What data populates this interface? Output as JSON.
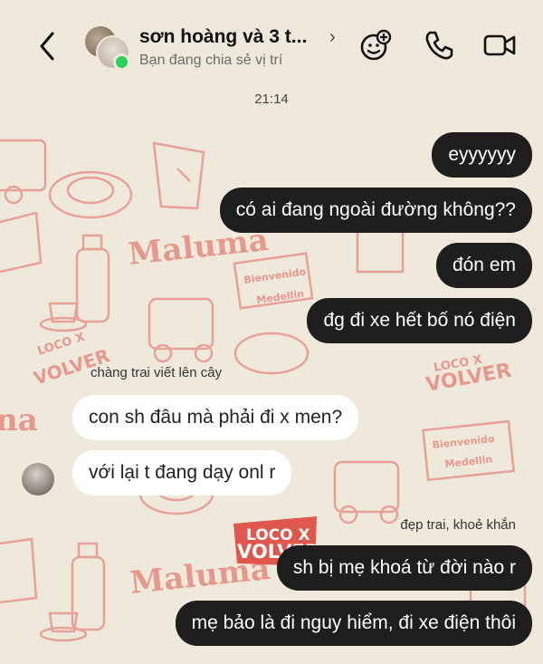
{
  "header": {
    "title": "sơn hoàng và 3 t...",
    "subtitle": "Bạn đang chia sẻ vị trí",
    "icons": [
      "back-arrow-icon",
      "chevron-right-icon",
      "add-effects-icon",
      "phone-icon",
      "video-camera-icon"
    ]
  },
  "timestamp": "21:14",
  "wallpaper_text": {
    "maluma_1": "Maluma",
    "maluma_2": "Maluma",
    "volver_1": "VOLVER",
    "volver_2": "VOLVER",
    "volver_3": "VOLVER",
    "loco_1": "LOCO X",
    "loco_2": "LOCO X",
    "loco_3": "LOCO X",
    "bienvenido_1": "Bienvenido",
    "bienvenido_2": "Bienvenido",
    "medellin_1": "Medellin",
    "medellin_2": "Medellin",
    "na": "na"
  },
  "messages": [
    {
      "text": "eyyyyyy",
      "direction": "outgoing"
    },
    {
      "text": "có ai đang ngoài đường không??",
      "direction": "outgoing"
    },
    {
      "text": "đón em",
      "direction": "outgoing"
    },
    {
      "text": "đg đi xe hết bố nó điện",
      "direction": "outgoing"
    },
    {
      "sender": "chàng trai viết lên cây",
      "text": "con sh đâu mà phải đi x men?",
      "direction": "incoming"
    },
    {
      "text": "với lại t đang dạy onl r",
      "direction": "incoming"
    },
    {
      "sender": "đẹp trai, khoẻ khắn",
      "text": "sh bị mẹ khoá từ đời nào r",
      "direction": "outgoing"
    },
    {
      "text": "mẹ bảo là đi nguy hiểm, đi xe điện thôi",
      "direction": "outgoing"
    }
  ],
  "colors": {
    "background": "#efe9dc",
    "wallpaper_pattern": "#e0574d",
    "outgoing_bubble": "#1e1e1e",
    "incoming_bubble": "#ffffff",
    "online_dot": "#2bd15a"
  }
}
